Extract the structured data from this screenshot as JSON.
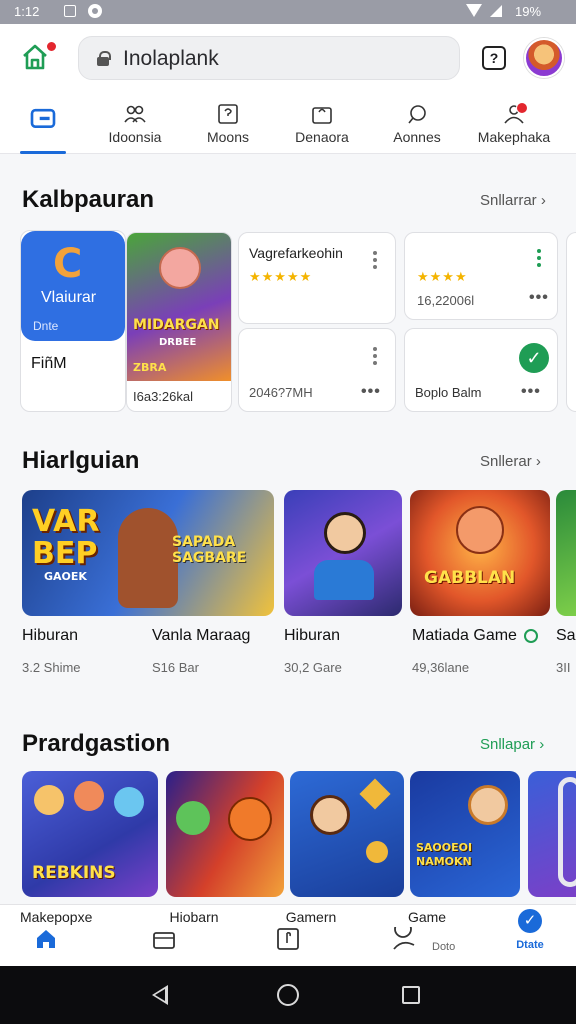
{
  "status_bar": {
    "time": "1:12",
    "battery": "19%"
  },
  "search": {
    "value": "Inolaplank"
  },
  "tabs": [
    {
      "label": "",
      "icon": "wallet-icon",
      "active": true
    },
    {
      "label": "Idoonsia",
      "icon": "people-icon"
    },
    {
      "label": "Moons",
      "icon": "help-square-icon"
    },
    {
      "label": "Denaora",
      "icon": "bag-icon"
    },
    {
      "label": "Aonnes",
      "icon": "chat-icon"
    },
    {
      "label": "Makephaka",
      "icon": "person-icon",
      "badge": true
    }
  ],
  "section1": {
    "title": "Kalbpauran",
    "see_all": "Snllarrar",
    "app_tile": {
      "logo_letter": "C",
      "name": "Vlaiurar",
      "sub": "Dnte",
      "caption": "FiñM"
    },
    "game_card": {
      "art_text": "MIDARGAN",
      "art_sub": "DRBEE",
      "art_bottom": "ZBRA",
      "caption": "I6a3:26kal"
    },
    "cards": [
      {
        "title": "Vagrefarkeohin",
        "stars": "★★★★★",
        "meta": ""
      },
      {
        "title": "",
        "stars": "★★★★",
        "meta": "16,22006l"
      },
      {
        "title": "",
        "stars": "",
        "meta": "2046?7MH"
      },
      {
        "title": "",
        "stars": "",
        "meta": "Boplo Balm"
      }
    ]
  },
  "section2": {
    "title": "Hiarlguian",
    "see_all": "Snllerar",
    "games": [
      {
        "art_text": "VAR BEP",
        "art_sub": "SAPADA SAGBARE",
        "art_tag": "GAOEK",
        "name": "Hiburan",
        "meta": "3.2 Shime"
      },
      {
        "art_text": "",
        "art_sub": "",
        "art_tag": "",
        "name": "Vanla Maraag",
        "meta": "S16 Bar"
      },
      {
        "art_text": "GABBLAN",
        "art_sub": "",
        "art_tag": "",
        "name": "Hiburan",
        "meta": "30,2 Gare"
      },
      {
        "art_text": "",
        "art_sub": "",
        "art_tag": "",
        "name": "Matiada Game",
        "meta": "49,36lane"
      },
      {
        "art_text": "",
        "art_sub": "",
        "art_tag": "",
        "name": "Sa",
        "meta": "3II"
      }
    ]
  },
  "section3": {
    "title": "Prardgastion",
    "see_all": "Snllapar",
    "games": [
      {
        "art_text": "REBKINS"
      },
      {
        "art_text": ""
      },
      {
        "art_text": ""
      },
      {
        "art_text": "SAOOEOI NAMOKN"
      },
      {
        "art_text": ""
      }
    ]
  },
  "bottom_nav": [
    {
      "label": "Makepopxe",
      "sub": "",
      "icon": "home-icon",
      "active": true
    },
    {
      "label": "Hiobarn",
      "sub": "",
      "icon": "wallet-icon"
    },
    {
      "label": "Gamern",
      "sub": "",
      "icon": "book-icon"
    },
    {
      "label": "Game",
      "sub": "Doto",
      "icon": "gamepad-icon"
    },
    {
      "label": "",
      "sub": "Dtate",
      "icon": "check-circle-icon"
    }
  ],
  "colors": {
    "accent": "#1a6ad9",
    "green": "#1f9d55",
    "badge": "#e3262e"
  }
}
